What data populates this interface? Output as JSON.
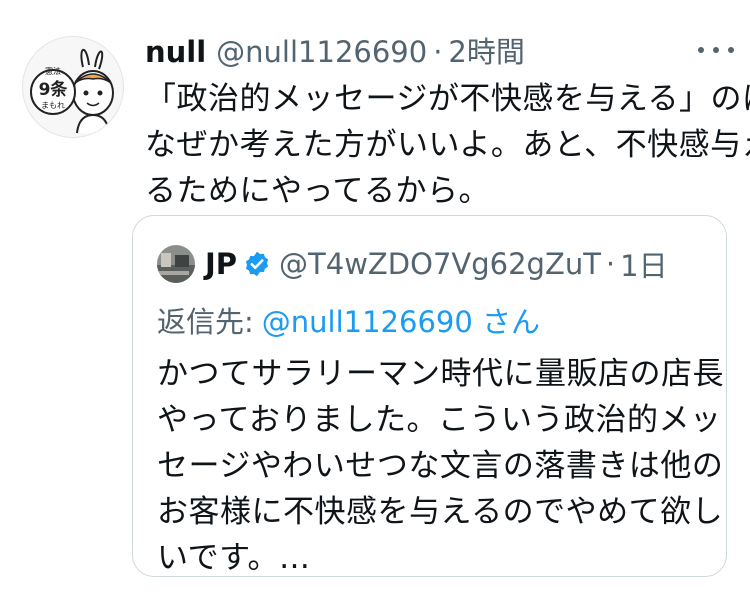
{
  "tweet": {
    "author_name": "null",
    "author_handle": "@null1126690",
    "separator": "·",
    "time": "2時間",
    "avatar_text": [
      "憲法",
      "9条",
      "まもれ"
    ],
    "text_lines": [
      "「政治的メッセージが不快感を与える」のは",
      "なぜか考えた方がいいよ。あと、不快感与え",
      "るためにやってるから。"
    ]
  },
  "quoted_tweet": {
    "author_name": "JP",
    "author_handle": "@T4wZDO7Vg62gZuT",
    "separator": "·",
    "time": "1日",
    "reply_label": "返信先:",
    "reply_target": "@null1126690 さん",
    "text_lines": [
      "かつてサラリーマン時代に量販店の店長",
      "やっておりました。こういう政治的メッ",
      "セージやわいせつな文言の落書きは他の",
      "お客様に不快感を与えるのでやめて欲し",
      "いです。…"
    ]
  },
  "icons": {
    "more": "more-horizontal-icon",
    "verified": "verified-badge-icon"
  },
  "colors": {
    "text": "#0f1419",
    "secondary": "#536471",
    "link": "#1d9bf0",
    "border": "#cfd9de"
  }
}
